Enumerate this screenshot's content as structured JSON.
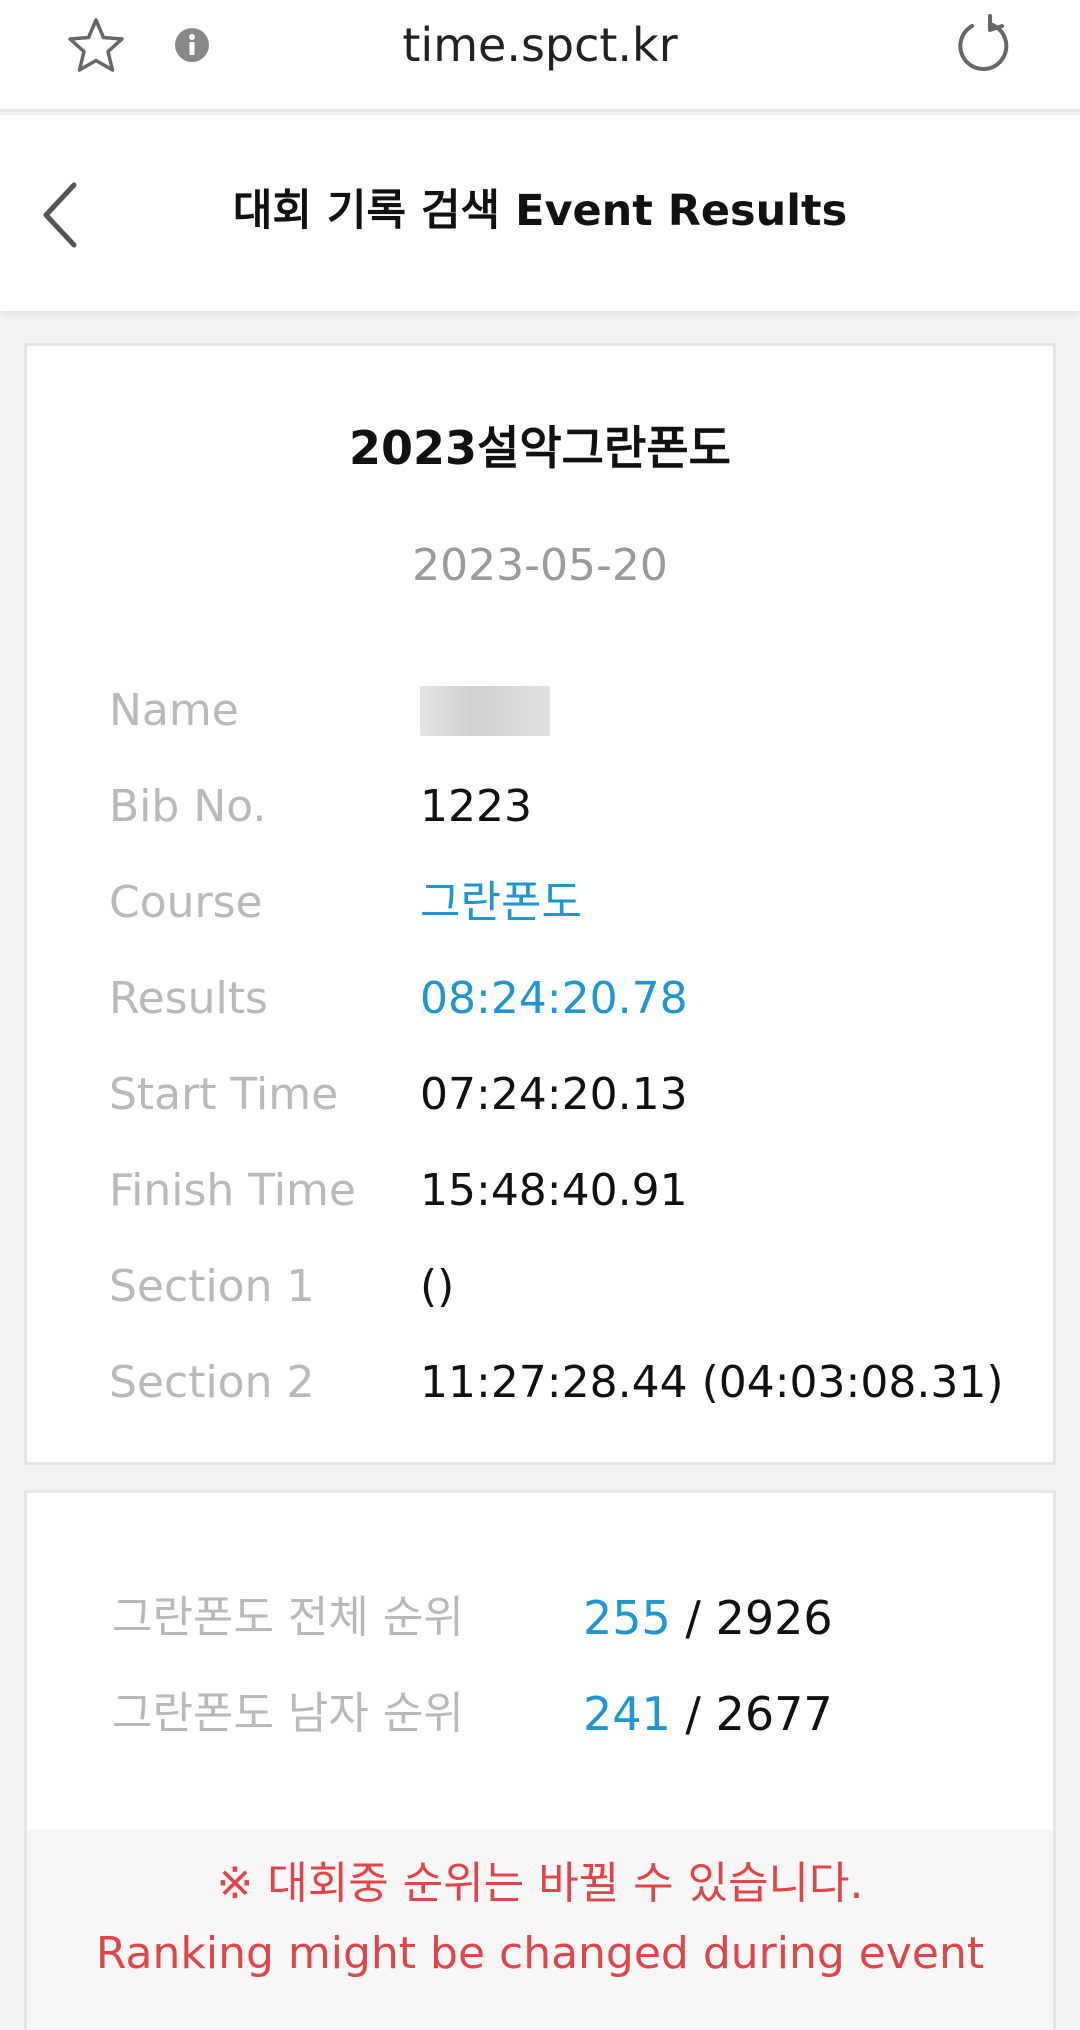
{
  "browser": {
    "url": "time.spct.kr",
    "icons": [
      "star-icon",
      "info-icon",
      "reload-icon"
    ]
  },
  "header": {
    "title": "대회 기록 검색 Event Results",
    "back_icon": "chevron-left-icon"
  },
  "result": {
    "event_name": "2023설악그란폰도",
    "date": "2023-05-20",
    "fields": [
      {
        "label": "Name",
        "value": "",
        "redacted": true
      },
      {
        "label": "Bib No.",
        "value": "1223"
      },
      {
        "label": "Course",
        "value": "그란폰도",
        "accent": true
      },
      {
        "label": "Results",
        "value": "08:24:20.78",
        "accent": true
      },
      {
        "label": "Start Time",
        "value": "07:24:20.13"
      },
      {
        "label": "Finish Time",
        "value": "15:48:40.91"
      },
      {
        "label": "Section 1",
        "value": "()"
      },
      {
        "label": "Section 2",
        "value": "11:27:28.44 (04:03:08.31)"
      }
    ]
  },
  "ranking": {
    "rows": [
      {
        "label": "그란폰도 전체 순위",
        "rank": "255",
        "separator": " / ",
        "total": "2926"
      },
      {
        "label": "그란폰도 남자 순위",
        "rank": "241",
        "separator": " / ",
        "total": "2677"
      }
    ],
    "notice_ko": "※ 대회중 순위는 바뀔 수 있습니다.",
    "notice_en": "Ranking might be changed during event"
  },
  "colors": {
    "accent": "#1d96d1",
    "label": "#b9b9b9",
    "warning": "#e0454a"
  }
}
